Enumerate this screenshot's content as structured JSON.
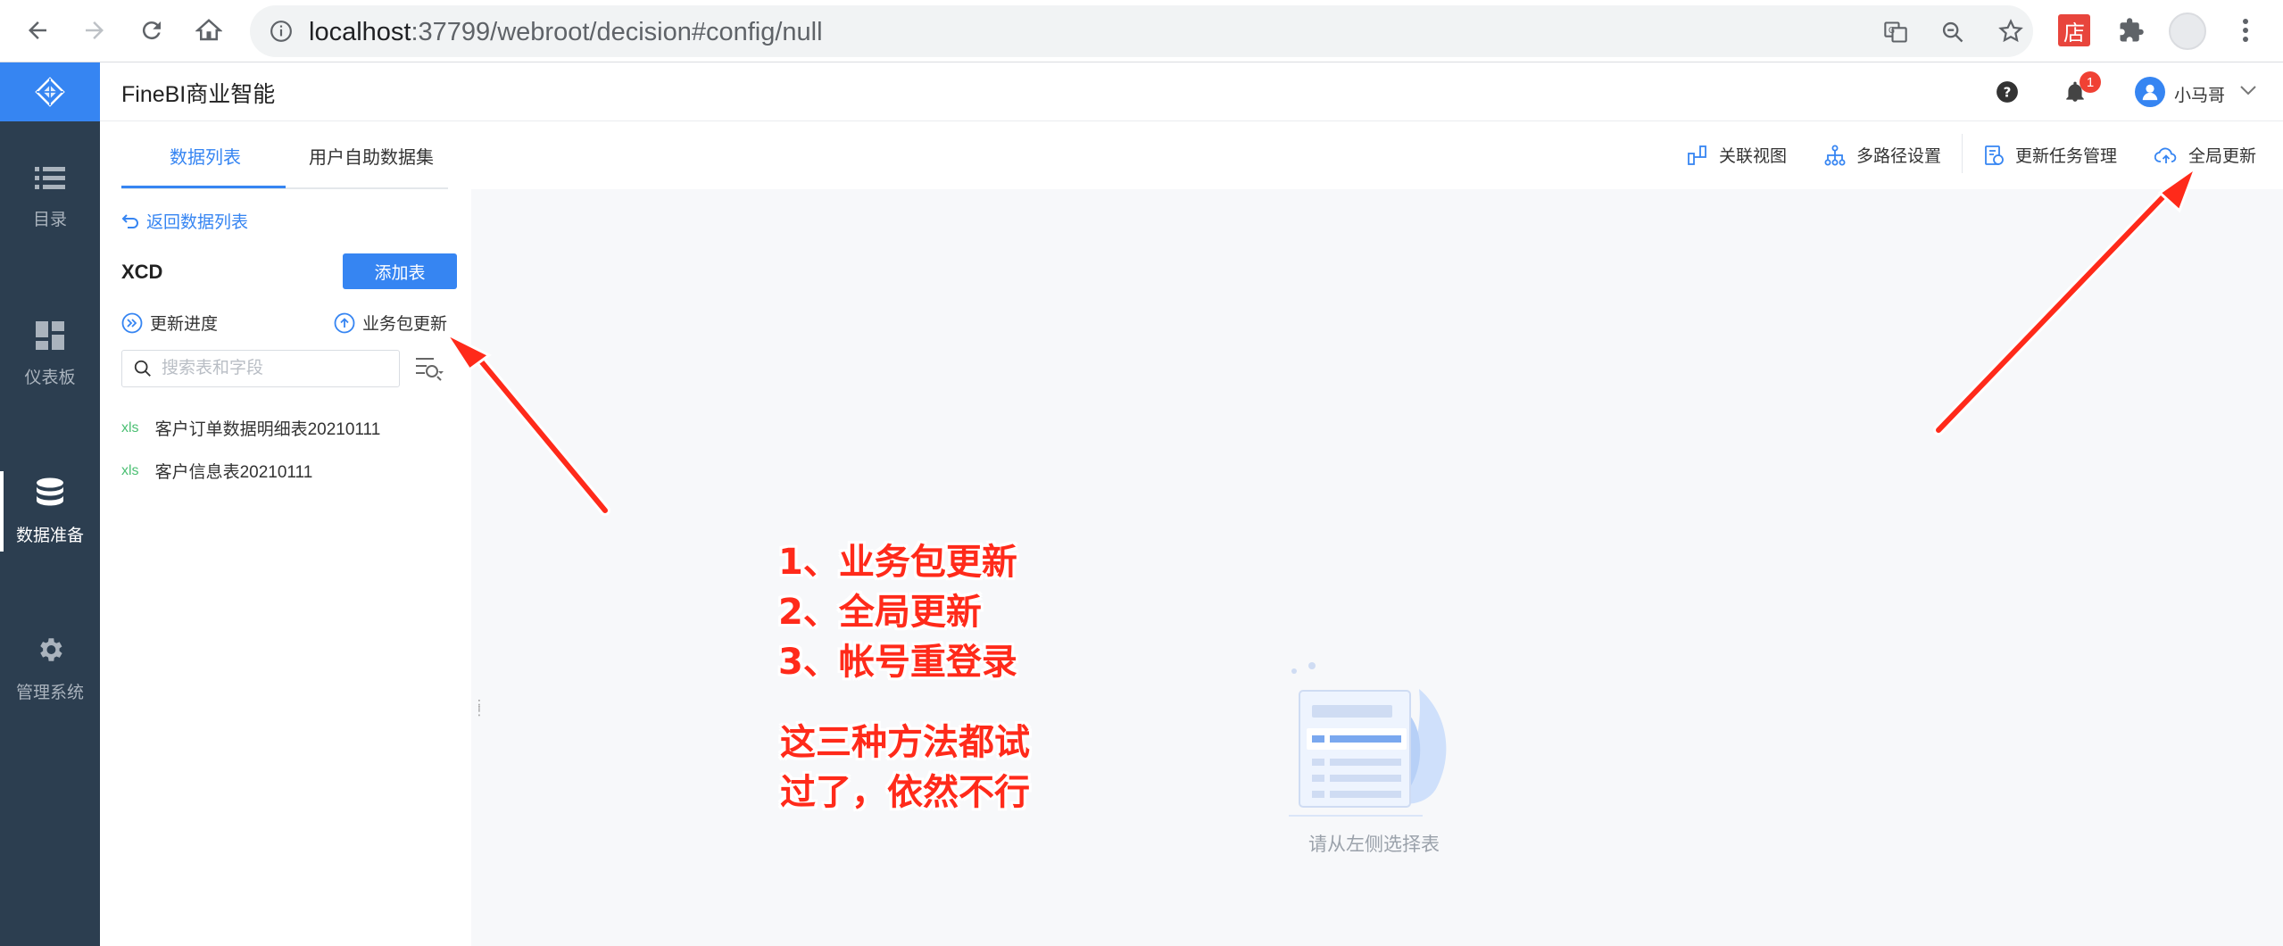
{
  "browser": {
    "url_host": "localhost",
    "url_rest": ":37799/webroot/decision#config/null"
  },
  "app": {
    "title": "FineBI商业智能",
    "notification_count": "1",
    "user_name": "小马哥"
  },
  "sidebar": {
    "items": [
      {
        "label": "目录",
        "icon": "list-icon"
      },
      {
        "label": "仪表板",
        "icon": "dashboard-icon"
      },
      {
        "label": "数据准备",
        "icon": "database-icon",
        "active": true
      },
      {
        "label": "管理系统",
        "icon": "gear-icon"
      }
    ]
  },
  "left_panel": {
    "tabs": [
      "数据列表",
      "用户自助数据集"
    ],
    "back_label": "返回数据列表",
    "package_name": "XCD",
    "add_table_label": "添加表",
    "update_progress_label": "更新进度",
    "package_update_label": "业务包更新",
    "search_placeholder": "搜索表和字段",
    "tables": [
      {
        "type": "xls",
        "name": "客户订单数据明细表20210111"
      },
      {
        "type": "xls",
        "name": "客户信息表20210111"
      }
    ]
  },
  "toolbar": {
    "relation_view": "关联视图",
    "multipath": "多路径设置",
    "task_manage": "更新任务管理",
    "global_update": "全局更新"
  },
  "content": {
    "empty_text": "请从左侧选择表"
  },
  "annotation": {
    "lines": [
      "1、业务包更新",
      "2、全局更新",
      "3、帐号重登录"
    ],
    "note_lines": [
      "这三种方法都试",
      "过了，依然不行"
    ],
    "color": "#ff2a1a"
  }
}
